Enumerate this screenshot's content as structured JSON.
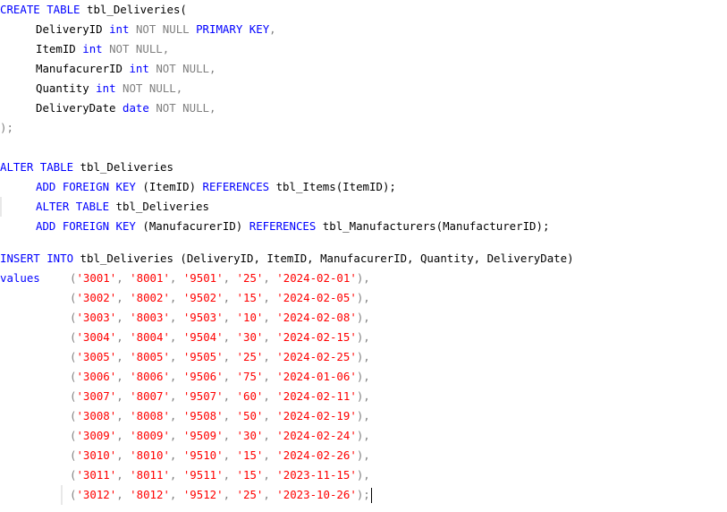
{
  "create": {
    "kw_create_table": "CREATE TABLE",
    "table_name": " tbl_Deliveries(",
    "columns": [
      {
        "name": "DeliveryID",
        "type": "int",
        "constraint": "NOT NULL",
        "extra": "PRIMARY KEY",
        "tail": ","
      },
      {
        "name": "ItemID",
        "type": "int",
        "constraint": "NOT NULL",
        "extra": "",
        "tail": ","
      },
      {
        "name": "ManufacurerID",
        "type": "int",
        "constraint": "NOT NULL",
        "extra": "",
        "tail": ","
      },
      {
        "name": "Quantity",
        "type": "int",
        "constraint": "NOT NULL",
        "extra": "",
        "tail": ","
      },
      {
        "name": "DeliveryDate",
        "type": "date",
        "constraint": "NOT NULL",
        "extra": "",
        "tail": ","
      }
    ],
    "close": ");"
  },
  "alter1": {
    "kw_alter_table": "ALTER TABLE",
    "table": " tbl_Deliveries",
    "kw_add_fk": "ADD FOREIGN KEY",
    "fk_col": " (ItemID) ",
    "kw_references": "REFERENCES",
    "ref": " tbl_Items(ItemID);"
  },
  "alter2": {
    "kw_alter_table": "ALTER TABLE",
    "table": " tbl_Deliveries",
    "kw_add_fk": "ADD FOREIGN KEY",
    "fk_col": " (ManufacurerID) ",
    "kw_references": "REFERENCES",
    "ref": " tbl_Manufacturers(ManufacturerID);"
  },
  "insert": {
    "kw_insert_into": "INSERT INTO",
    "target": " tbl_Deliveries (DeliveryID, ItemID, ManufacurerID, Quantity, DeliveryDate)",
    "kw_values": "values",
    "rows": [
      [
        "'3001'",
        "'8001'",
        "'9501'",
        "'25'",
        "'2024-02-01'"
      ],
      [
        "'3002'",
        "'8002'",
        "'9502'",
        "'15'",
        "'2024-02-05'"
      ],
      [
        "'3003'",
        "'8003'",
        "'9503'",
        "'10'",
        "'2024-02-08'"
      ],
      [
        "'3004'",
        "'8004'",
        "'9504'",
        "'30'",
        "'2024-02-15'"
      ],
      [
        "'3005'",
        "'8005'",
        "'9505'",
        "'25'",
        "'2024-02-25'"
      ],
      [
        "'3006'",
        "'8006'",
        "'9506'",
        "'75'",
        "'2024-01-06'"
      ],
      [
        "'3007'",
        "'8007'",
        "'9507'",
        "'60'",
        "'2024-02-11'"
      ],
      [
        "'3008'",
        "'8008'",
        "'9508'",
        "'50'",
        "'2024-02-19'"
      ],
      [
        "'3009'",
        "'8009'",
        "'9509'",
        "'30'",
        "'2024-02-24'"
      ],
      [
        "'3010'",
        "'8010'",
        "'9510'",
        "'15'",
        "'2024-02-26'"
      ],
      [
        "'3011'",
        "'8011'",
        "'9511'",
        "'15'",
        "'2023-11-15'"
      ],
      [
        "'3012'",
        "'8012'",
        "'9512'",
        "'25'",
        "'2023-10-26'"
      ]
    ]
  },
  "colors": {
    "keyword": "#0000ff",
    "operator": "#808080",
    "string": "#ff0000",
    "text": "#000000"
  }
}
